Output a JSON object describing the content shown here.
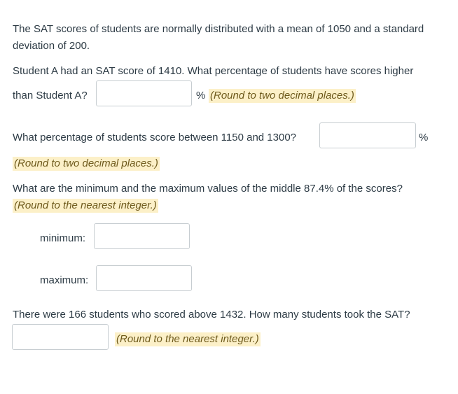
{
  "intro": {
    "line1": "The SAT scores of students are normally distributed with a mean of 1050 and a standard",
    "line2": "deviation of 200."
  },
  "q1": {
    "line1": "Student A had an SAT score of 1410.  What percentage of students have scores higher",
    "line2": "than Student A?",
    "unit": "%",
    "hint": "(Round to two decimal places.)",
    "value": ""
  },
  "q2": {
    "text": "What percentage of students score between 1150 and 1300?",
    "unit": "%",
    "hint": "(Round to two decimal places.)",
    "value": ""
  },
  "q3": {
    "text": "What are the minimum and the maximum values of the middle 87.4% of the scores?",
    "hint": "(Round to the nearest integer.)",
    "min_label": "minimum:",
    "max_label": "maximum:",
    "min_value": "",
    "max_value": ""
  },
  "q4": {
    "text": "There were 166 students who scored above 1432.  How many students took the SAT?",
    "hint": "(Round to the nearest integer.)",
    "value": ""
  }
}
